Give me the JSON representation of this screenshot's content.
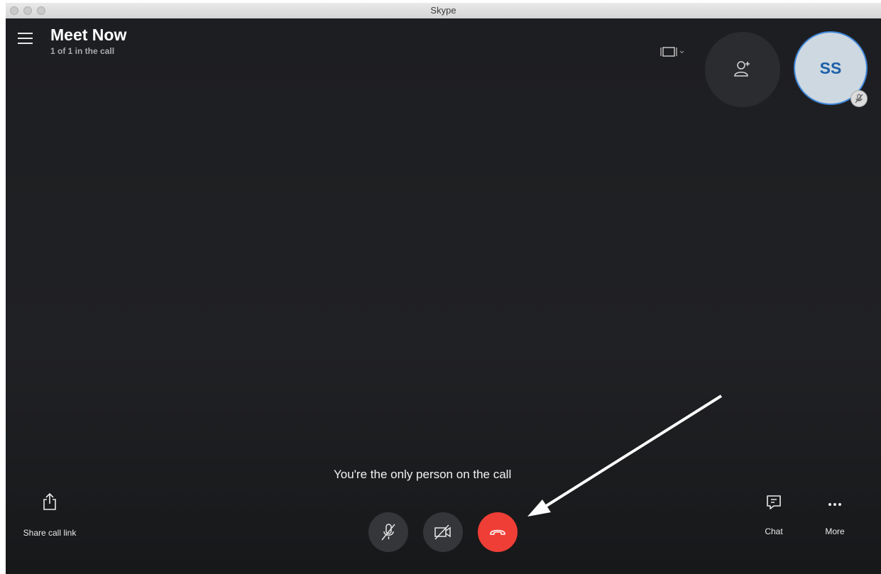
{
  "window": {
    "title": "Skype"
  },
  "header": {
    "title": "Meet Now",
    "subtitle": "1 of 1 in the call"
  },
  "participant": {
    "initials": "SS",
    "muted": true
  },
  "call": {
    "status_message": "You're the only person on the call"
  },
  "actions": {
    "share_label": "Share call link",
    "chat_label": "Chat",
    "more_label": "More"
  },
  "colors": {
    "background": "#1d1e21",
    "hang_up": "#ef3e36",
    "control_button": "#35363a",
    "avatar_ring": "#3f86d8",
    "avatar_text": "#1d5fa8"
  },
  "icons": {
    "menu": "hamburger-icon",
    "layout": "layout-frame-icon",
    "add_people": "add-person-icon",
    "share": "share-upload-icon",
    "mic": "mic-muted-icon",
    "video": "video-off-icon",
    "hang_up": "hang-up-icon",
    "chat": "chat-icon",
    "more": "ellipsis-icon"
  }
}
